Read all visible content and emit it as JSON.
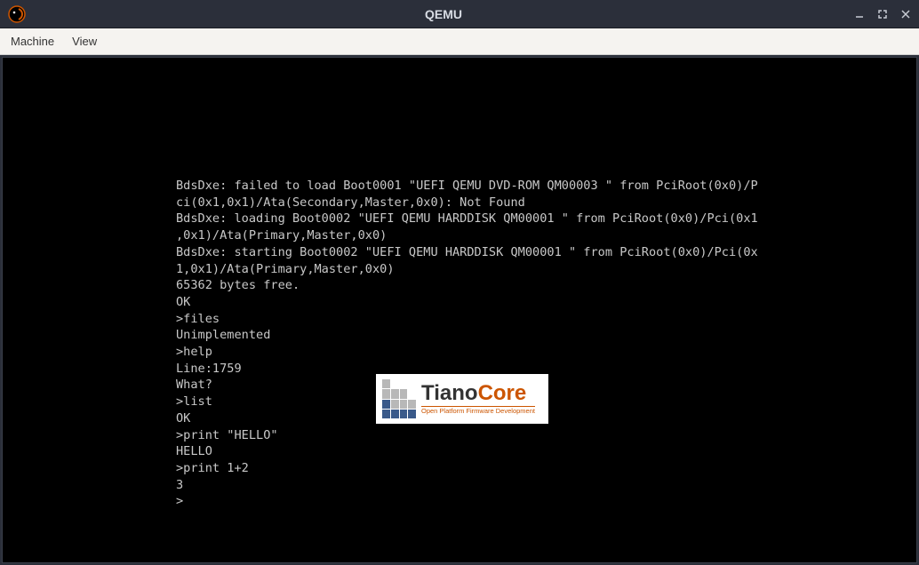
{
  "window": {
    "title": "QEMU"
  },
  "menu": {
    "machine": "Machine",
    "view": "View"
  },
  "terminal": {
    "line1": "BdsDxe: failed to load Boot0001 \"UEFI QEMU DVD-ROM QM00003 \" from PciRoot(0x0)/P",
    "line2": "ci(0x1,0x1)/Ata(Secondary,Master,0x0): Not Found",
    "line3": "BdsDxe: loading Boot0002 \"UEFI QEMU HARDDISK QM00001 \" from PciRoot(0x0)/Pci(0x1",
    "line4": ",0x1)/Ata(Primary,Master,0x0)",
    "line5": "BdsDxe: starting Boot0002 \"UEFI QEMU HARDDISK QM00001 \" from PciRoot(0x0)/Pci(0x",
    "line6": "1,0x1)/Ata(Primary,Master,0x0)",
    "line7": "65362 bytes free.",
    "line8": "OK",
    "line9": ">files",
    "line10": "Unimplemented",
    "line11": ">help",
    "line12": "Line:1759",
    "line13": "What?",
    "line14": ">list",
    "line15": "OK",
    "line16": ">print \"HELLO\"",
    "line17": "HELLO",
    "line18": ">print 1+2",
    "line19": "3",
    "line20": ">"
  },
  "logo": {
    "tiano": "Tiano",
    "core": "Core",
    "subtitle": "Open Platform Firmware Development"
  }
}
